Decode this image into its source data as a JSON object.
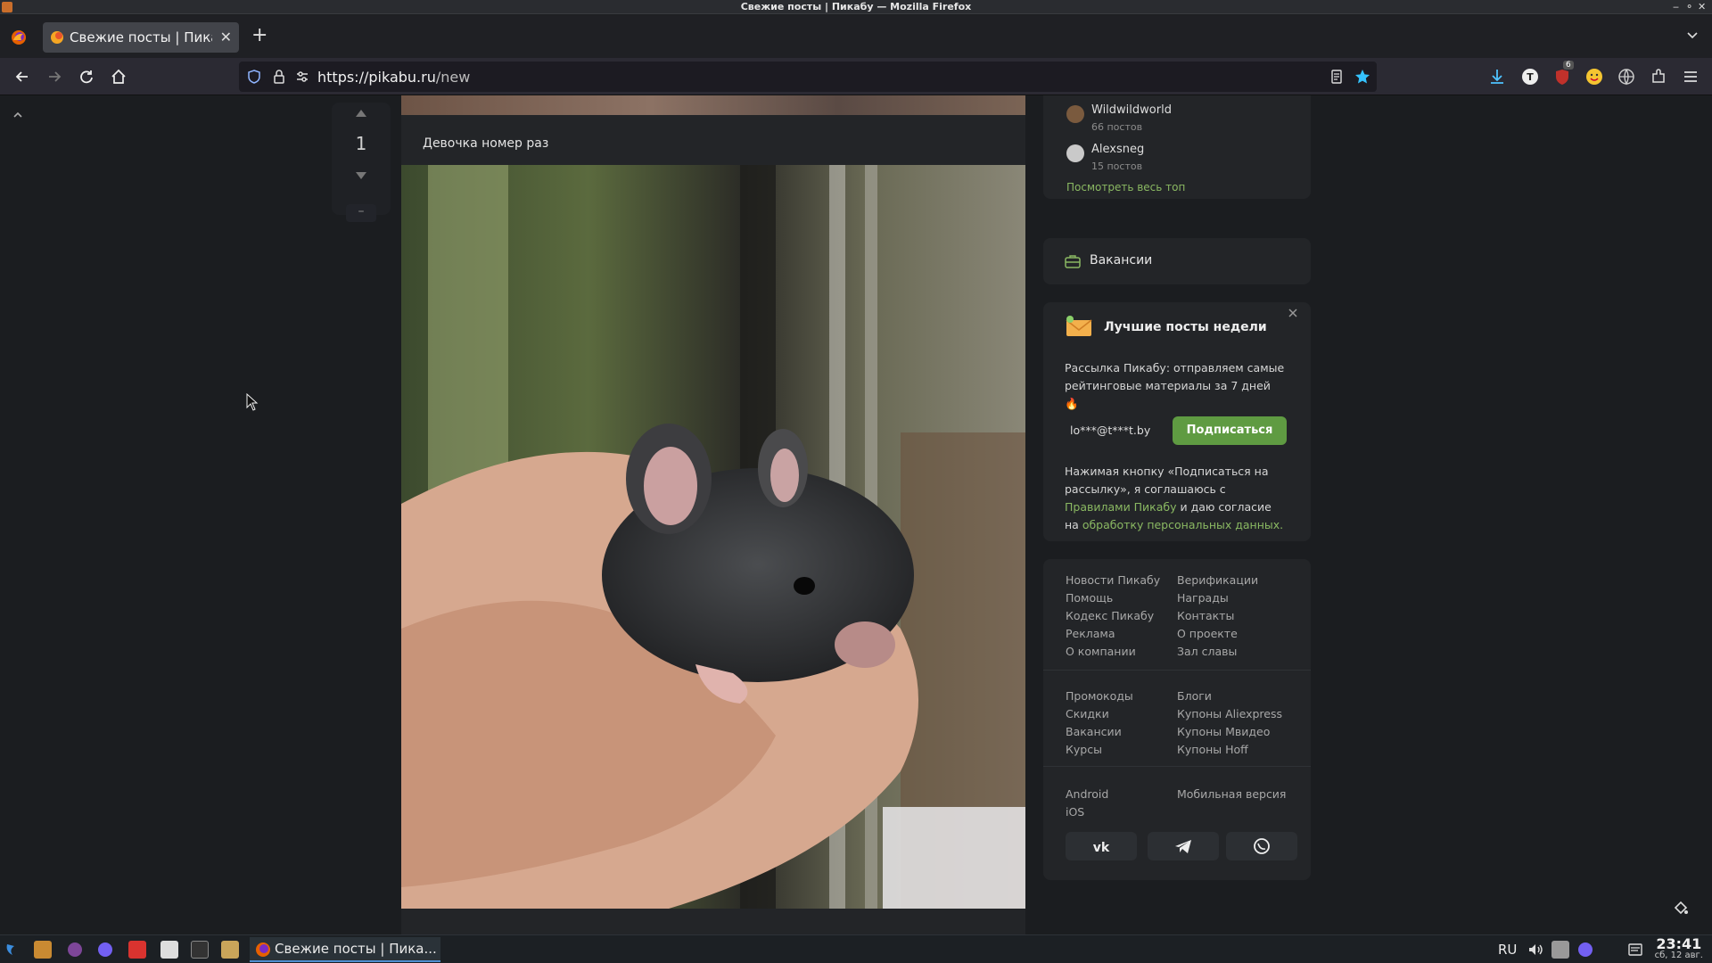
{
  "window": {
    "title": "Свежие посты | Пикабу — Mozilla Firefox",
    "controls": [
      "‒",
      "⚬",
      "✕"
    ]
  },
  "tab": {
    "title": "Свежие посты | Пикабу",
    "close": "✕",
    "new_tab": "+"
  },
  "navbar": {
    "url_host": "https://pikabu.ru",
    "url_path": "/new"
  },
  "toolbar": {
    "extension_badge": "6"
  },
  "post": {
    "rating": "1",
    "minus_label": "–",
    "caption": "Девочка номер раз"
  },
  "sidebar": {
    "top_authors": [
      {
        "name": "Wildwildworld",
        "count": "66 постов"
      },
      {
        "name": "Alexsneg",
        "count": "15 постов"
      }
    ],
    "see_all_top": "Посмотреть весь топ",
    "vacancies_title": "Вакансии",
    "newsletter": {
      "title": "Лучшие посты недели",
      "description": "Рассылка Пикабу: отправляем самые рейтинговые материалы за 7 дней",
      "fire": "🔥",
      "email_value": "lo***@t***t.by",
      "subscribe_label": "Подписаться",
      "consent_prefix": "Нажимая кнопку «Подписаться на рассылку», я соглашаюсь с ",
      "consent_link1": "Правилами Пикабу",
      "consent_middle": " и даю согласие на ",
      "consent_link2": "обработку персональных данных."
    },
    "footer_col1": [
      "Новости Пикабу",
      "Помощь",
      "Кодекс Пикабу",
      "Реклама",
      "О компании"
    ],
    "footer_col2": [
      "Верификации",
      "Награды",
      "Контакты",
      "О проекте",
      "Зал славы"
    ],
    "footer_col3": [
      "Промокоды",
      "Скидки",
      "Вакансии",
      "Курсы"
    ],
    "footer_col4": [
      "Блоги",
      "Купоны Aliexpress",
      "Купоны Мвидео",
      "Купоны Hoff"
    ],
    "apps": [
      "Android",
      "iOS"
    ],
    "mobile_version": "Мобильная версия"
  },
  "taskbar": {
    "window_label": "Свежие посты | Пика...",
    "lang": "RU",
    "time": "23:41",
    "date": "сб, 12 авг."
  }
}
